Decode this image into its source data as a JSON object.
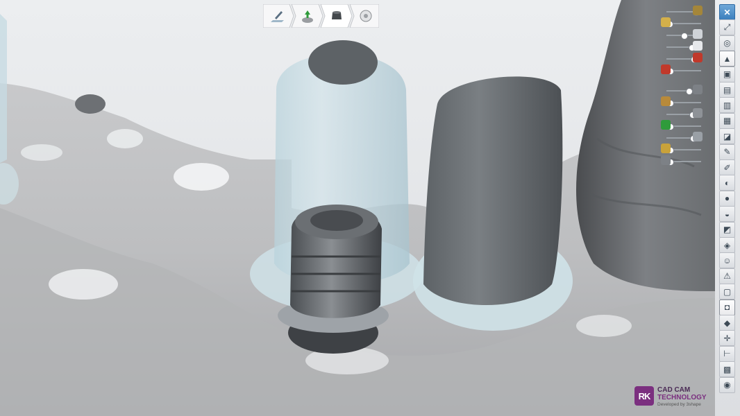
{
  "workflow": {
    "steps": [
      {
        "icon": "margin-pencil-icon"
      },
      {
        "icon": "insertion-arrow-icon"
      },
      {
        "icon": "abutment-icon"
      },
      {
        "icon": "disc-icon"
      }
    ]
  },
  "visibility_sliders": [
    {
      "icon": "implant-icon",
      "level": 0.92
    },
    {
      "icon": "gold-crown-icon",
      "level": 0.08
    },
    {
      "icon": "tooth-icon",
      "level": 0.55
    },
    {
      "icon": "crown-icon",
      "level": 0.78
    },
    {
      "icon": "scissors-icon",
      "level": 0.85
    },
    {
      "icon": "red-cap-icon",
      "level": 0.1
    },
    {
      "icon": "screw-icon",
      "level": 0.7
    },
    {
      "icon": "pin-icon",
      "level": 0.1
    },
    {
      "icon": "post-icon",
      "level": 0.8
    },
    {
      "icon": "green-marker-icon",
      "level": 0.1
    },
    {
      "icon": "needle-icon",
      "level": 0.82
    },
    {
      "icon": "brush-icon",
      "level": 0.1
    },
    {
      "icon": "tool-icon",
      "level": 0.1
    }
  ],
  "toolbar": [
    {
      "icon": "close-icon",
      "glyph": "✕"
    },
    {
      "icon": "fullscreen-icon",
      "glyph": "⤢"
    },
    {
      "icon": "rotate-icon",
      "glyph": "◎"
    },
    {
      "icon": "cap-icon",
      "glyph": "▲"
    },
    {
      "icon": "layers-icon",
      "glyph": "▣"
    },
    {
      "icon": "view-front-icon",
      "glyph": "▤"
    },
    {
      "icon": "view-side-icon",
      "glyph": "▥"
    },
    {
      "icon": "view-top-icon",
      "glyph": "▦"
    },
    {
      "icon": "section-icon",
      "glyph": "◪"
    },
    {
      "icon": "measure-icon",
      "glyph": "✎"
    },
    {
      "icon": "sculpt-icon",
      "glyph": "✐"
    },
    {
      "icon": "smooth-icon",
      "glyph": "◐"
    },
    {
      "icon": "sphere-icon",
      "glyph": "●"
    },
    {
      "icon": "wax-icon",
      "glyph": "◒"
    },
    {
      "icon": "cut-plane-icon",
      "glyph": "◩"
    },
    {
      "icon": "scan-icon",
      "glyph": "◈"
    },
    {
      "icon": "face-icon",
      "glyph": "☺"
    },
    {
      "icon": "warning-icon",
      "glyph": "⚠"
    },
    {
      "icon": "box-icon",
      "glyph": "▢"
    },
    {
      "icon": "camera-icon",
      "glyph": "◘"
    },
    {
      "icon": "cube-icon",
      "glyph": "◆"
    },
    {
      "icon": "axis-icon",
      "glyph": "✛"
    },
    {
      "icon": "ruler-icon",
      "glyph": "⊢"
    },
    {
      "icon": "gallery-icon",
      "glyph": "▩"
    },
    {
      "icon": "color-wheel-icon",
      "glyph": "◉"
    }
  ],
  "logo": {
    "mark": "RK",
    "line1": "CAD CAM",
    "line2": "TECHNOLOGY",
    "line3": "Developed by 3shape",
    "brand_color": "#7b2f7f"
  }
}
